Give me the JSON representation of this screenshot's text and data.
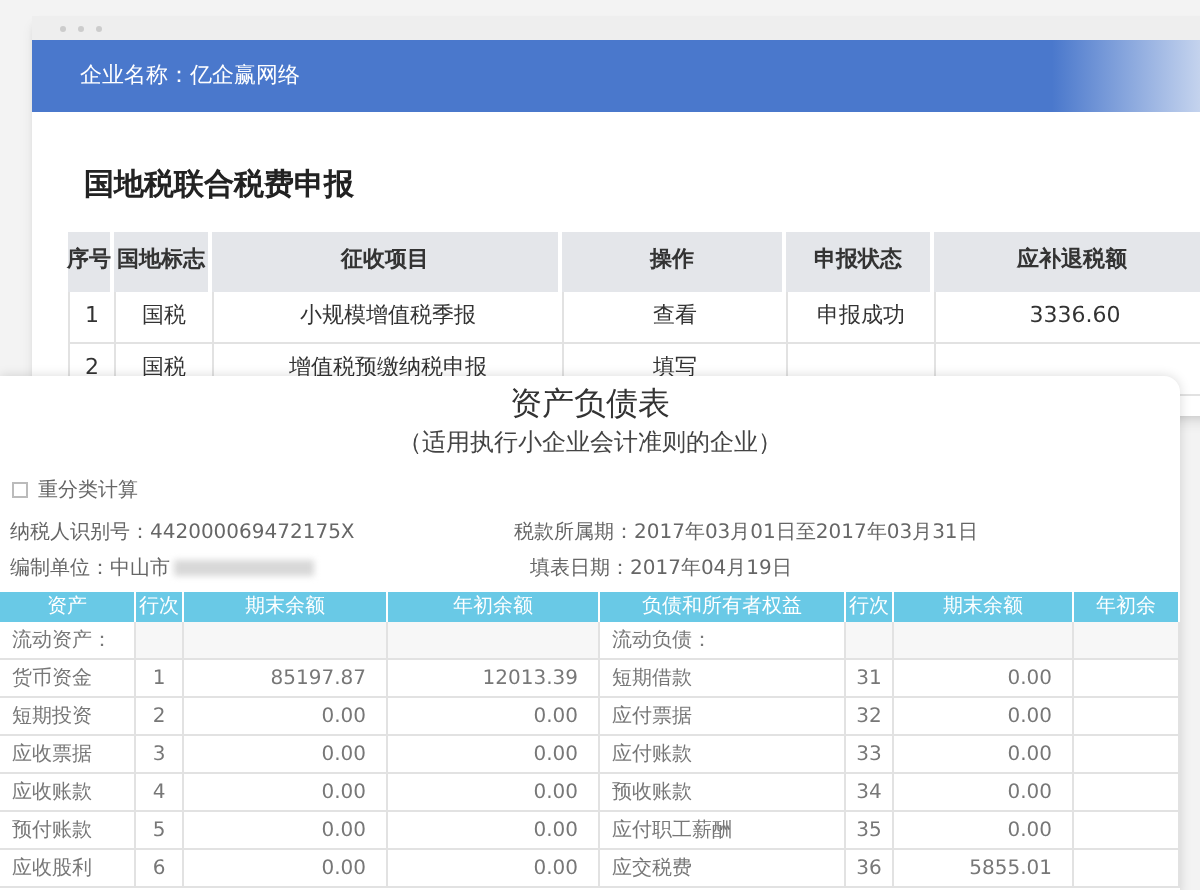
{
  "back_window": {
    "company": "企业名称：亿企赢网络",
    "title": "国地税联合税费申报",
    "columns": [
      "序号",
      "国地标志",
      "征收项目",
      "操作",
      "申报状态",
      "应补退税额"
    ],
    "rows": [
      {
        "no": "1",
        "flag": "国税",
        "item": "小规模增值税季报",
        "action": "查看",
        "status": "申报成功",
        "amount": "3336.60"
      },
      {
        "no": "2",
        "flag": "国税",
        "item": "增值税预缴纳税申报",
        "action": "填写"
      }
    ]
  },
  "front_window": {
    "title": "资产负债表",
    "subtitle": "（适用执行小企业会计准则的企业）",
    "checkbox": {
      "label": "重分类计算",
      "checked": false
    },
    "taxpayer_id": "纳税人识别号：442000069472175X",
    "period": "税款所属期：2017年03月01日至2017年03月31日",
    "unit": "编制单位：中山市",
    "fill_date": "填表日期：2017年04月19日",
    "columns": [
      "资产",
      "行次",
      "期末余额",
      "年初余额",
      "负债和所有者权益",
      "行次",
      "期末余额",
      "年初余"
    ],
    "section_left": "流动资产：",
    "section_right": "流动负债：",
    "rows": [
      {
        "asset": "货币资金",
        "line": "1",
        "end": "85197.87",
        "begin": "12013.39",
        "liability": "短期借款",
        "line2": "31",
        "end2": "0.00"
      },
      {
        "asset": "短期投资",
        "line": "2",
        "end": "0.00",
        "begin": "0.00",
        "liability": "应付票据",
        "line2": "32",
        "end2": "0.00"
      },
      {
        "asset": "应收票据",
        "line": "3",
        "end": "0.00",
        "begin": "0.00",
        "liability": "应付账款",
        "line2": "33",
        "end2": "0.00"
      },
      {
        "asset": "应收账款",
        "line": "4",
        "end": "0.00",
        "begin": "0.00",
        "liability": "预收账款",
        "line2": "34",
        "end2": "0.00"
      },
      {
        "asset": "预付账款",
        "line": "5",
        "end": "0.00",
        "begin": "0.00",
        "liability": "应付职工薪酬",
        "line2": "35",
        "end2": "0.00"
      },
      {
        "asset": "应收股利",
        "line": "6",
        "end": "0.00",
        "begin": "0.00",
        "liability": "应交税费",
        "line2": "36",
        "end2": "5855.01"
      }
    ]
  }
}
